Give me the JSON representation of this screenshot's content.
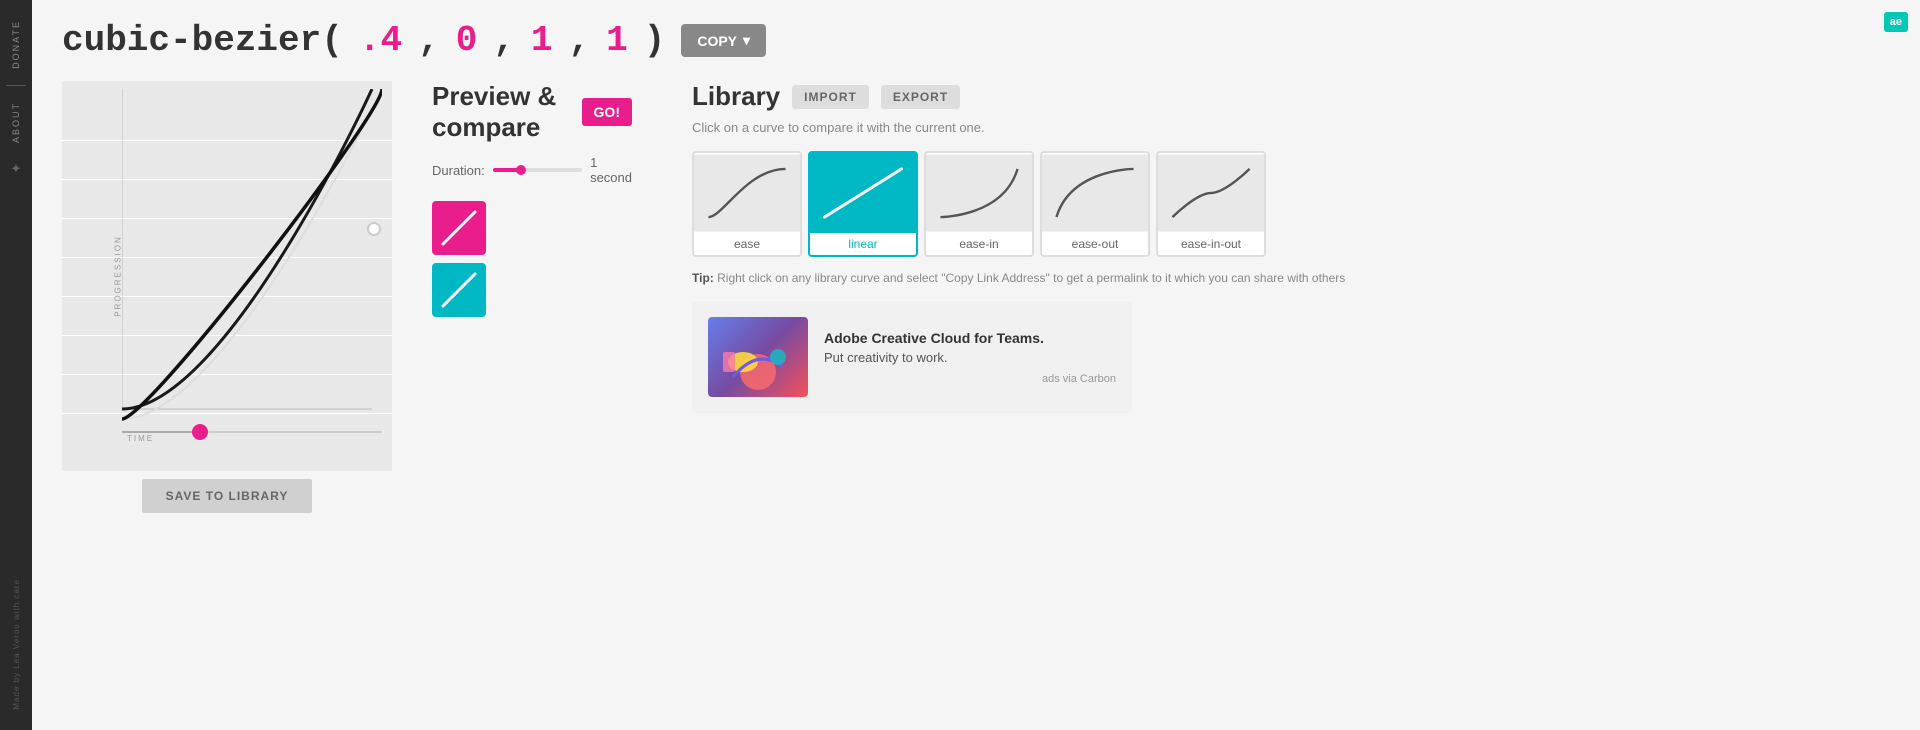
{
  "sidebar": {
    "donate_label": "DONATE",
    "about_label": "About",
    "asterisk": "*",
    "credit": "Made by Lea Verou with care"
  },
  "header": {
    "formula_prefix": "cubic-bezier(",
    "param1": ".4",
    "comma1": ",",
    "param2": "0",
    "comma2": ",",
    "param3": "1",
    "comma3": ",",
    "param4": "1",
    "formula_suffix": ")",
    "copy_label": "COPY",
    "copy_arrow": "▾"
  },
  "preview": {
    "title": "Preview & compare",
    "go_label": "GO!",
    "duration_label": "Duration:",
    "duration_value": "1 second"
  },
  "library": {
    "title": "Library",
    "import_label": "IMPORT",
    "export_label": "EXPORT",
    "subtitle": "Click on a curve to compare it with the current one.",
    "curves": [
      {
        "name": "ease",
        "active": false
      },
      {
        "name": "linear",
        "active": true
      },
      {
        "name": "ease-in",
        "active": false
      },
      {
        "name": "ease-out",
        "active": false
      },
      {
        "name": "ease-in-out",
        "active": false
      }
    ],
    "tip": "Tip:",
    "tip_text": " Right click on any library curve and select \"Copy Link Address\" to get a permalink to it which you can share with others"
  },
  "ad": {
    "title": "Adobe Creative Cloud for Teams.",
    "subtitle": "Put creativity to work.",
    "via": "ads via Carbon"
  },
  "graph": {
    "axis_y": "PROGRESSION",
    "axis_x": "TIME"
  },
  "save_btn": "SAVE TO LIBRARY",
  "logo": "ae"
}
